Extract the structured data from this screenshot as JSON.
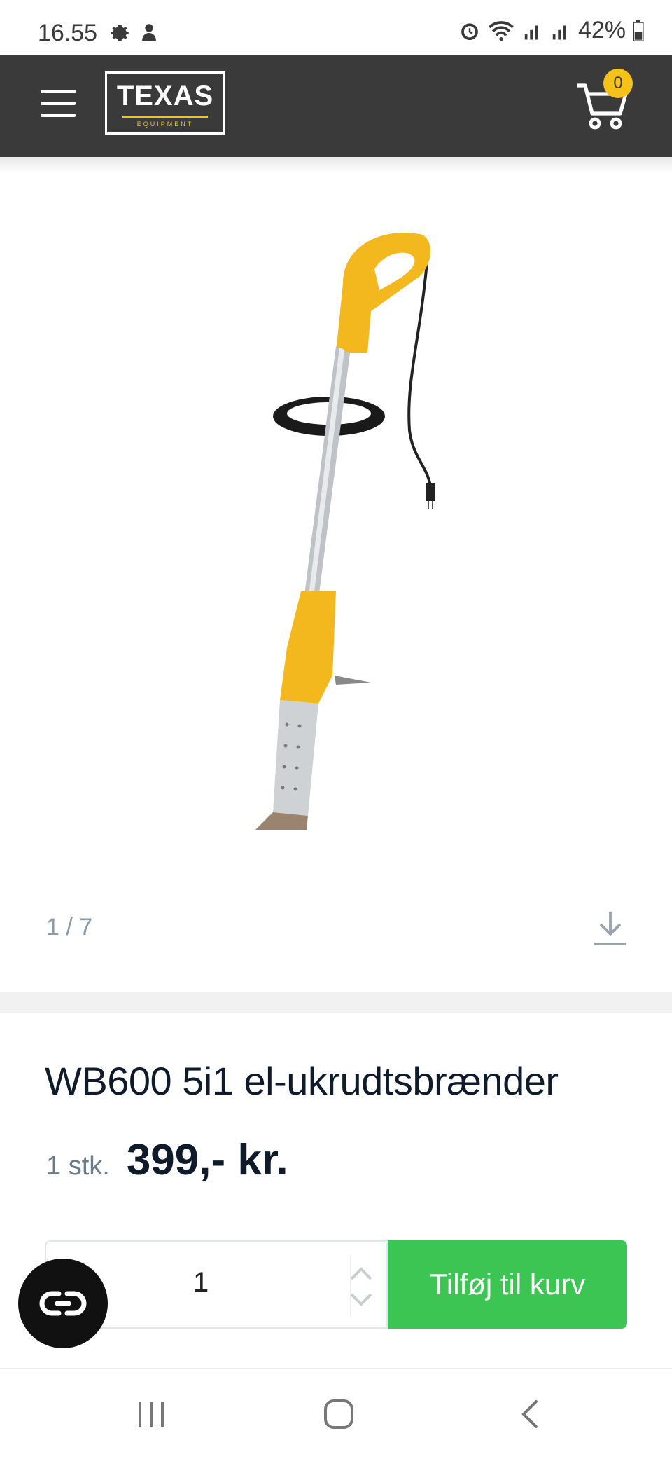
{
  "status_bar": {
    "time": "16.55",
    "battery": "42%",
    "icons": [
      "settings-icon",
      "notification-icon",
      "alarm-icon",
      "wifi-icon",
      "signal-icon",
      "signal-icon",
      "battery-icon"
    ]
  },
  "header": {
    "logo_main": "TEXAS",
    "logo_sub": "EQUIPMENT",
    "cart_count": "0",
    "colors": {
      "bar": "#3a3a3a",
      "accent": "#f5c21b"
    }
  },
  "gallery": {
    "counter": "1 / 7"
  },
  "product": {
    "title": "WB600 5i1 el-ukrudtsbrænder",
    "unit": "1 stk.",
    "price": "399,- kr."
  },
  "purchase": {
    "quantity": "1",
    "add_label": "Tilføj til kurv",
    "button_color": "#3dc553"
  }
}
